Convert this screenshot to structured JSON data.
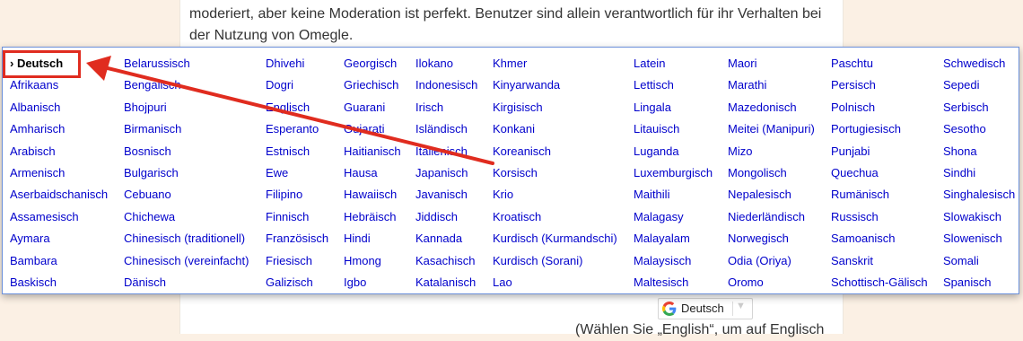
{
  "page": {
    "paragraph_top": "moderiert, aber keine Moderation ist perfekt. Benutzer sind allein verantwortlich für ihr Verhalten bei der Nutzung von Omegle.",
    "paragraph_bottom": "(Wählen Sie „English“, um auf Englisch"
  },
  "translate_widget": {
    "current_language": "Deutsch",
    "icon": "google-g-icon",
    "caret_icon": "triangle-down-icon"
  },
  "language_menu": {
    "selected_prefix": "›",
    "columns": [
      [
        "Deutsch",
        "Afrikaans",
        "Albanisch",
        "Amharisch",
        "Arabisch",
        "Armenisch",
        "Aserbaidschanisch",
        "Assamesisch",
        "Aymara",
        "Bambara",
        "Baskisch"
      ],
      [
        "Belarussisch",
        "Bengalisch",
        "Bhojpuri",
        "Birmanisch",
        "Bosnisch",
        "Bulgarisch",
        "Cebuano",
        "Chichewa",
        "Chinesisch (traditionell)",
        "Chinesisch (vereinfacht)",
        "Dänisch"
      ],
      [
        "Dhivehi",
        "Dogri",
        "Englisch",
        "Esperanto",
        "Estnisch",
        "Ewe",
        "Filipino",
        "Finnisch",
        "Französisch",
        "Friesisch",
        "Galizisch"
      ],
      [
        "Georgisch",
        "Griechisch",
        "Guarani",
        "Gujarati",
        "Haitianisch",
        "Hausa",
        "Hawaiisch",
        "Hebräisch",
        "Hindi",
        "Hmong",
        "Igbo"
      ],
      [
        "Ilokano",
        "Indonesisch",
        "Irisch",
        "Isländisch",
        "Italienisch",
        "Japanisch",
        "Javanisch",
        "Jiddisch",
        "Kannada",
        "Kasachisch",
        "Katalanisch"
      ],
      [
        "Khmer",
        "Kinyarwanda",
        "Kirgisisch",
        "Konkani",
        "Koreanisch",
        "Korsisch",
        "Krio",
        "Kroatisch",
        "Kurdisch (Kurmandschi)",
        "Kurdisch (Sorani)",
        "Lao"
      ],
      [
        "Latein",
        "Lettisch",
        "Lingala",
        "Litauisch",
        "Luganda",
        "Luxemburgisch",
        "Maithili",
        "Malagasy",
        "Malayalam",
        "Malaysisch",
        "Maltesisch"
      ],
      [
        "Maori",
        "Marathi",
        "Mazedonisch",
        "Meitei (Manipuri)",
        "Mizo",
        "Mongolisch",
        "Nepalesisch",
        "Niederländisch",
        "Norwegisch",
        "Odia (Oriya)",
        "Oromo"
      ],
      [
        "Paschtu",
        "Persisch",
        "Polnisch",
        "Portugiesisch",
        "Punjabi",
        "Quechua",
        "Rumänisch",
        "Russisch",
        "Samoanisch",
        "Sanskrit",
        "Schottisch-Gälisch"
      ],
      [
        "Schwedisch",
        "Sepedi",
        "Serbisch",
        "Sesotho",
        "Shona",
        "Sindhi",
        "Singhalesisch",
        "Slowakisch",
        "Slowenisch",
        "Somali",
        "Spanisch"
      ]
    ]
  },
  "annotation": {
    "color": "#e02c1f"
  }
}
